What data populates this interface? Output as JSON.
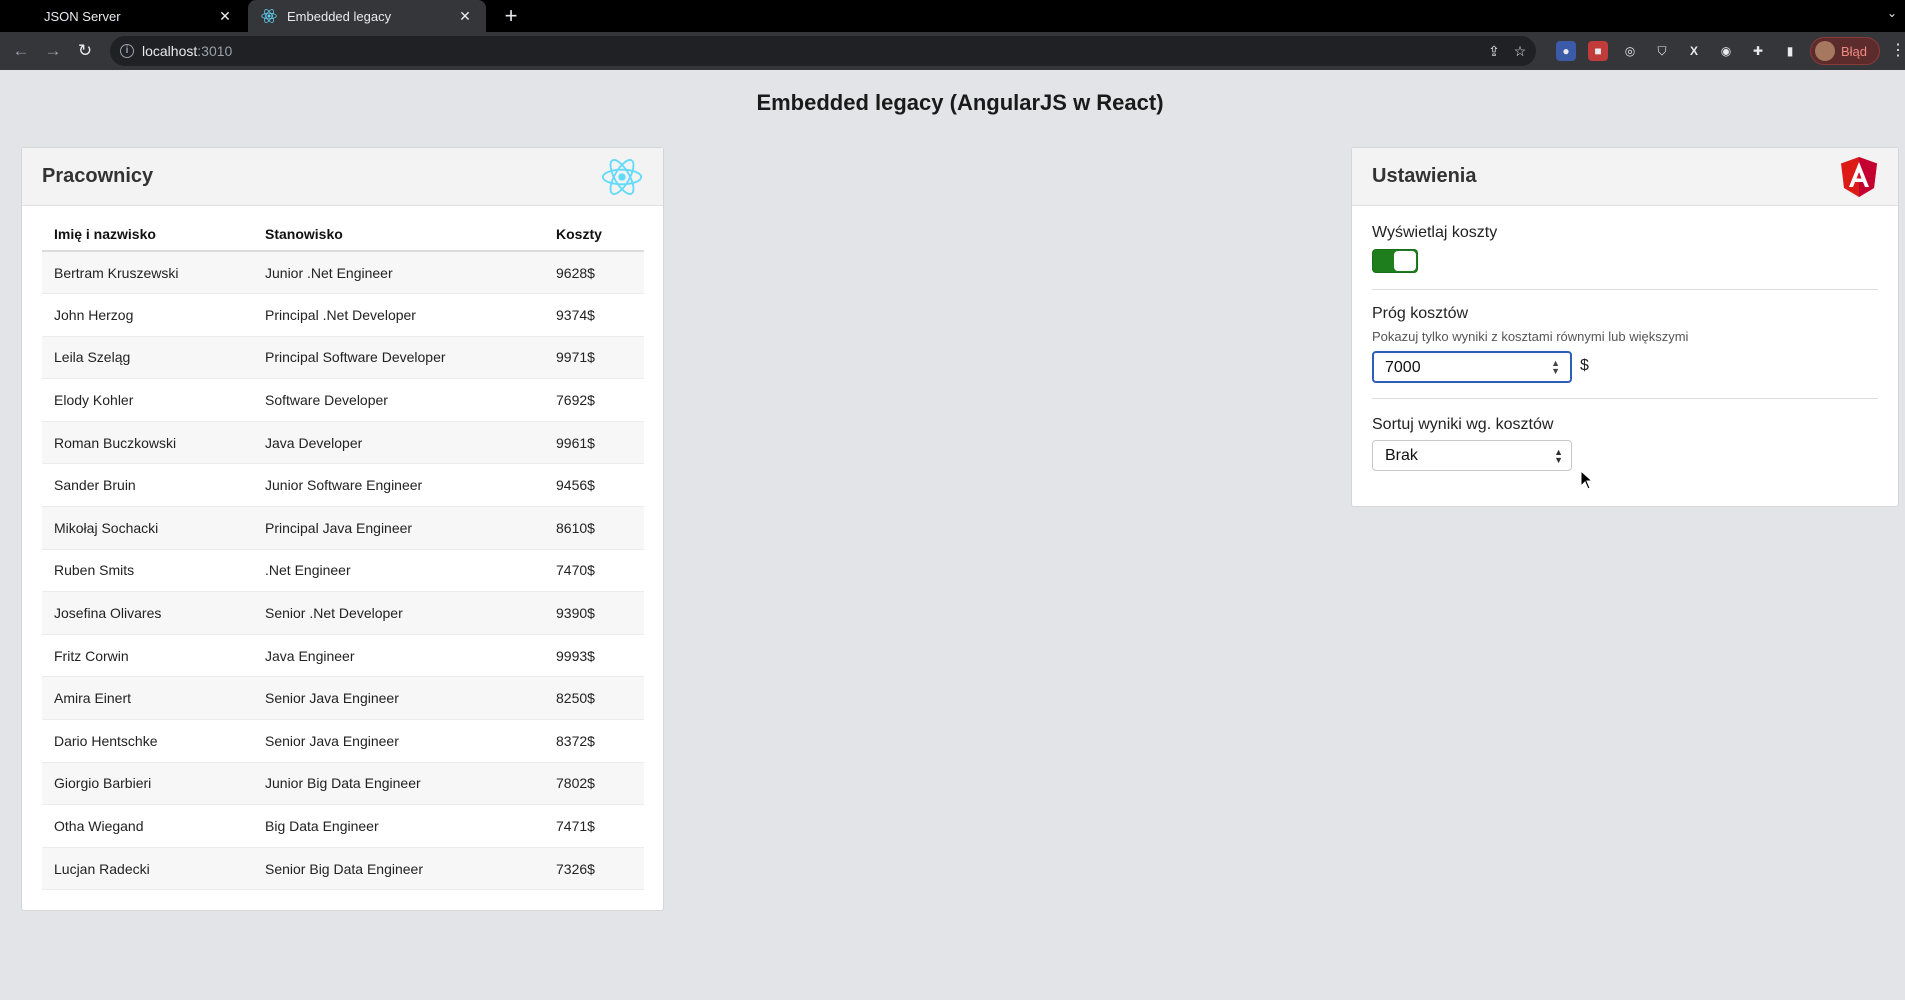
{
  "browser": {
    "tabs": [
      {
        "title": "JSON Server",
        "active": false
      },
      {
        "title": "Embedded legacy",
        "active": true
      }
    ],
    "url_host": "localhost",
    "url_port": ":3010",
    "profile_label": "Błąd"
  },
  "page": {
    "title": "Embedded legacy (AngularJS w React)"
  },
  "employees": {
    "card_title": "Pracownicy",
    "columns": [
      "Imię i nazwisko",
      "Stanowisko",
      "Koszty"
    ],
    "rows": [
      [
        "Bertram Kruszewski",
        "Junior .Net Engineer",
        "9628$"
      ],
      [
        "John Herzog",
        "Principal .Net Developer",
        "9374$"
      ],
      [
        "Leila Szeląg",
        "Principal Software Developer",
        "9971$"
      ],
      [
        "Elody Kohler",
        "Software Developer",
        "7692$"
      ],
      [
        "Roman Buczkowski",
        "Java Developer",
        "9961$"
      ],
      [
        "Sander Bruin",
        "Junior Software Engineer",
        "9456$"
      ],
      [
        "Mikołaj Sochacki",
        "Principal Java Engineer",
        "8610$"
      ],
      [
        "Ruben Smits",
        ".Net Engineer",
        "7470$"
      ],
      [
        "Josefina Olivares",
        "Senior .Net Developer",
        "9390$"
      ],
      [
        "Fritz Corwin",
        "Java Engineer",
        "9993$"
      ],
      [
        "Amira Einert",
        "Senior Java Engineer",
        "8250$"
      ],
      [
        "Dario Hentschke",
        "Senior Java Engineer",
        "8372$"
      ],
      [
        "Giorgio Barbieri",
        "Junior Big Data Engineer",
        "7802$"
      ],
      [
        "Otha Wiegand",
        "Big Data Engineer",
        "7471$"
      ],
      [
        "Lucjan Radecki",
        "Senior Big Data Engineer",
        "7326$"
      ]
    ]
  },
  "settings": {
    "card_title": "Ustawienia",
    "show_costs_label": "Wyświetlaj koszty",
    "show_costs_enabled": true,
    "threshold_label": "Próg kosztów",
    "threshold_hint": "Pokazuj tylko wyniki z kosztami równymi lub większymi",
    "threshold_value": "7000",
    "threshold_unit": "$",
    "sort_label": "Sortuj wyniki wg. kosztów",
    "sort_value": "Brak"
  },
  "colors": {
    "toggle_on": "#1e7e1e",
    "react_logo": "#61dafb",
    "angular_logo": "#dd1b16",
    "input_focus": "#2d5fb8"
  }
}
